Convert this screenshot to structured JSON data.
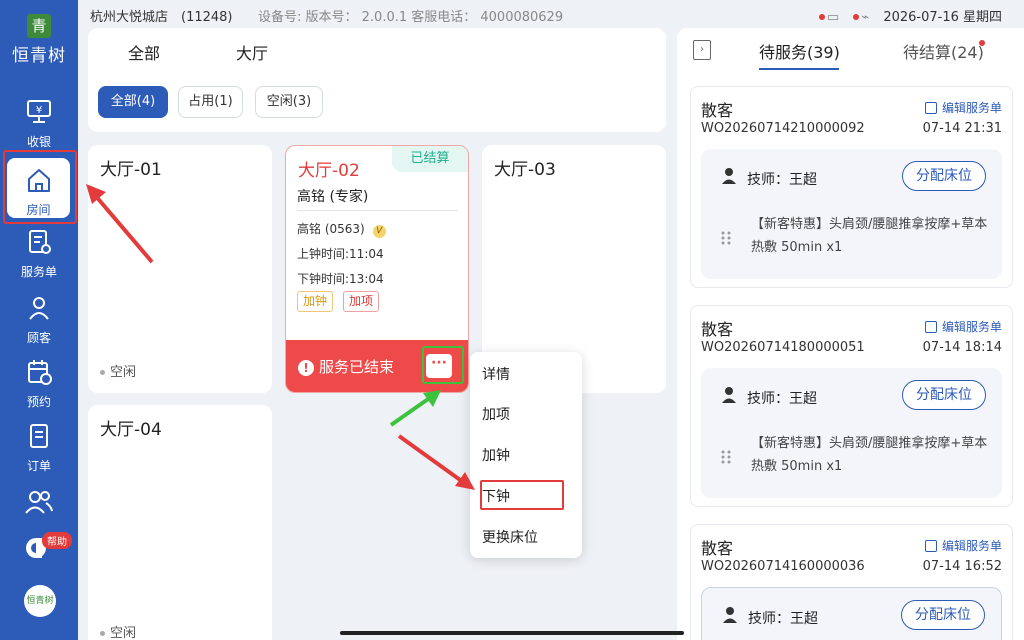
{
  "statusbar": {
    "store": "杭州大悦城店　(11248)",
    "device": "设备号:  版本号： 2.0.0.1   客服电话： 4000080629",
    "datetime": "2026-07-16 星期四"
  },
  "sidebar": {
    "logo_mark": "青",
    "logo_text": "恒青树",
    "items": [
      {
        "label": "收银",
        "icon": "cashier-icon"
      },
      {
        "label": "房间",
        "icon": "home-icon"
      },
      {
        "label": "服务单",
        "icon": "service-order-icon"
      },
      {
        "label": "顾客",
        "icon": "customer-icon"
      },
      {
        "label": "预约",
        "icon": "calendar-icon"
      },
      {
        "label": "订单",
        "icon": "order-icon"
      }
    ],
    "help_badge": "帮助",
    "avatar_text": "恒青树"
  },
  "areas": {
    "tabs": [
      "全部",
      "大厅"
    ],
    "chips": [
      "全部(4)",
      "占用(1)",
      "空闲(3)"
    ]
  },
  "rooms": {
    "r1": {
      "name": "大厅-01",
      "status": "空闲"
    },
    "r2": {
      "name": "大厅-02",
      "badge": "已结算",
      "tech": "高铭 (专家)",
      "tech_code": "高铭 (0563)",
      "vip": "V",
      "start": "上钟时间:11:04",
      "end": "下钟时间:13:04",
      "tags": [
        "加钟",
        "加项"
      ],
      "status_bar": "服务已结束",
      "more": "···"
    },
    "r3": {
      "name": "大厅-03"
    },
    "r4": {
      "name": "大厅-04",
      "status": "空闲"
    }
  },
  "menu": {
    "items": [
      "详情",
      "加项",
      "加钟",
      "下钟",
      "更换床位"
    ]
  },
  "right": {
    "tabs": [
      "待服务(39)",
      "待结算(24)"
    ],
    "orders": [
      {
        "customer": "散客",
        "no": "WO20260714210000092",
        "time": "07-14 21:31",
        "edit": "编辑服务单",
        "tech": "技师：王超",
        "assign": "分配床位",
        "service": "【新客特惠】头肩颈/腰腿推拿按摩+草本热敷 50min x1"
      },
      {
        "customer": "散客",
        "no": "WO20260714180000051",
        "time": "07-14 18:14",
        "edit": "编辑服务单",
        "tech": "技师：王超",
        "assign": "分配床位",
        "service": "【新客特惠】头肩颈/腰腿推拿按摩+草本热敷 50min x1"
      },
      {
        "customer": "散客",
        "no": "WO20260714160000036",
        "time": "07-14 16:52",
        "edit": "编辑服务单",
        "tech": "技师：王超",
        "assign": "分配床位",
        "service": ""
      }
    ]
  },
  "colors": {
    "primary": "#2d5bb8",
    "danger": "#ef4a4a",
    "success": "#1fae8c",
    "highlight_red": "#e33b3b",
    "highlight_green": "#3cc23c"
  }
}
